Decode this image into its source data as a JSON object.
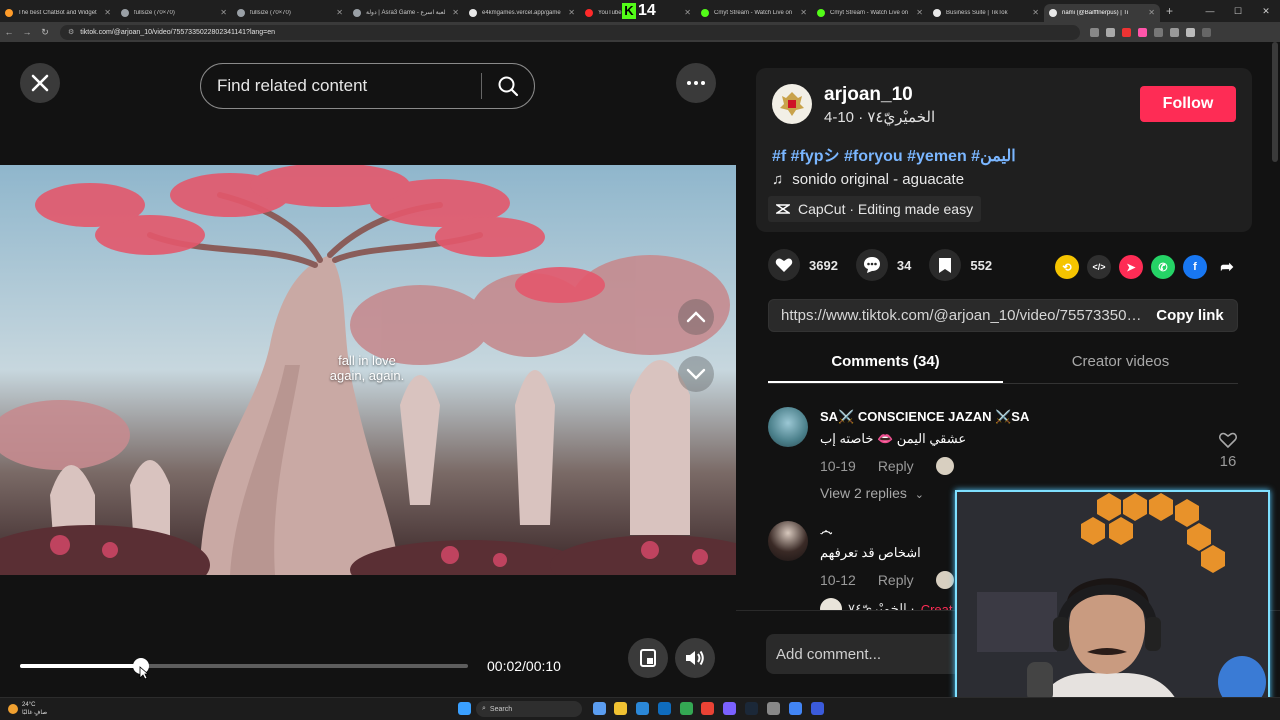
{
  "browser": {
    "tabs": [
      {
        "label": "The best ChatBot and Widget",
        "color": "#ff9c2a"
      },
      {
        "label": "fullsize (70×70)",
        "color": "#9aa0a6"
      },
      {
        "label": "fullsize (70×70)",
        "color": "#9aa0a6"
      },
      {
        "label": "دولة | Asra3 Game - لعبة اسرع",
        "color": "#9aa0a6"
      },
      {
        "label": "e4kmgames.vercel.app/game",
        "color": "#e8e8e8"
      },
      {
        "label": "YouTube",
        "color": "#ff2a2a"
      },
      {
        "label": "Cmyt Stream - Watch Live on",
        "color": "#53fc18"
      },
      {
        "label": "Cmyt Stream - Watch Live on",
        "color": "#53fc18"
      },
      {
        "label": "Business Suite | TikTok",
        "color": "#e8e8e8"
      },
      {
        "label": "nami (@Baifffnerpus) | Ti",
        "color": "#e8e8e8",
        "active": true
      }
    ],
    "url": "tiktok.com/@arjoan_10/video/7557335022802341141?lang=en",
    "overlay_badge": "14"
  },
  "player": {
    "search_placeholder": "Find related content",
    "caption_line1": "fall in love",
    "caption_line2": "again, again.",
    "time": "00:02/00:10",
    "progress": 0.27
  },
  "post": {
    "username": "arjoan_10",
    "display_name": "الخميْريّ٧٤",
    "date": "10-4",
    "follow_label": "Follow",
    "hashtags": "#f #fypシ #foryou #yemen #اليمن",
    "music": "sonido original - aguacate",
    "capcut": "CapCut · Editing made easy",
    "likes": "3692",
    "comments": "34",
    "saves": "552",
    "link": "https://www.tiktok.com/@arjoan_10/video/755733502...",
    "copy_label": "Copy link"
  },
  "tabs": {
    "comments": "Comments (34)",
    "creator": "Creator videos"
  },
  "comments": [
    {
      "name": "SA⚔️ CONSCIENCE JAZAN ⚔️SA",
      "text": "عشقي اليمن 👄 خاصته إب",
      "date": "10-19",
      "reply": "Reply",
      "likes": "16",
      "view_replies": "View 2 replies"
    },
    {
      "name": "෴",
      "text": "اشخاص قد تعرفهم",
      "date": "10-12",
      "reply": "Reply"
    }
  ],
  "reply_peek": {
    "name": "الخميْريّ٧٤ ·",
    "link": "Creat"
  },
  "add_comment_placeholder": "Add comment...",
  "taskbar": {
    "temp": "24°C",
    "weather": "صافٍ غالبًا",
    "search": "Search"
  }
}
